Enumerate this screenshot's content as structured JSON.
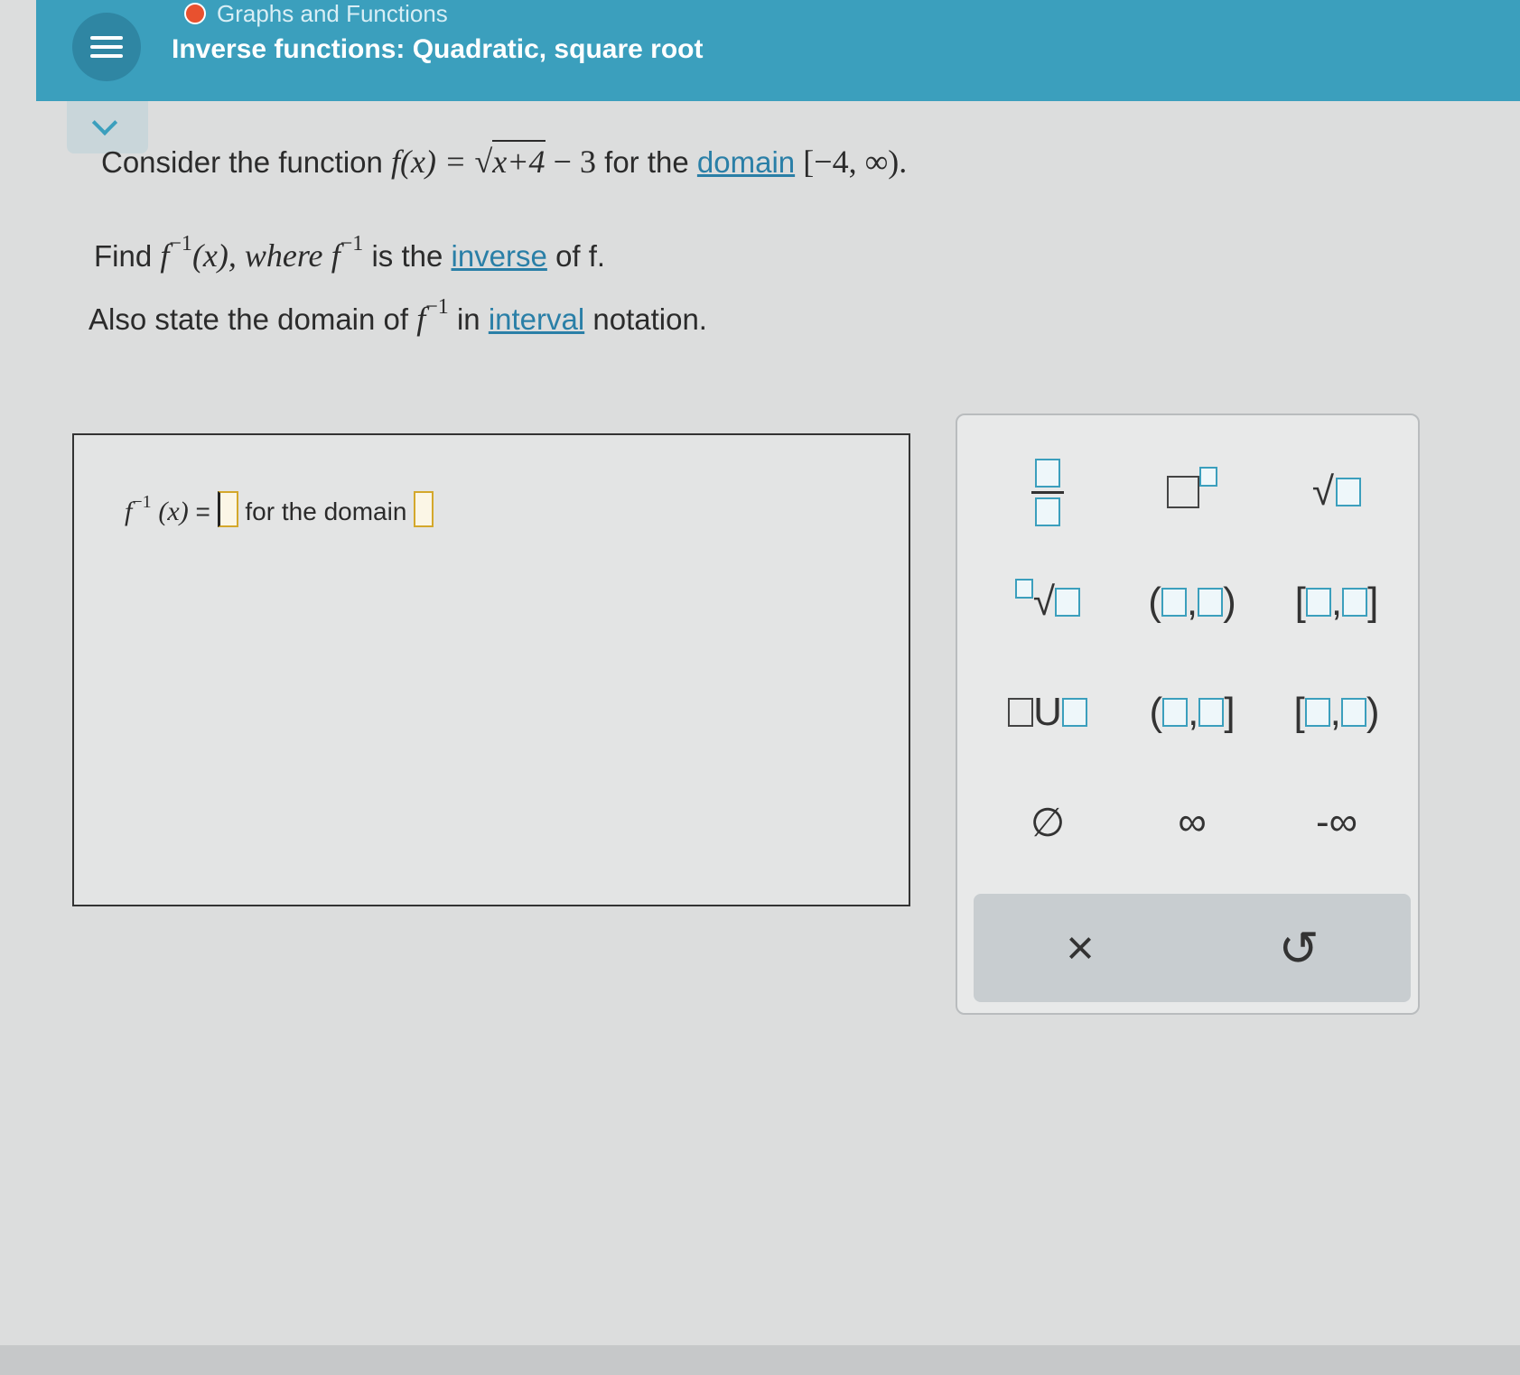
{
  "header": {
    "breadcrumb": "Graphs and Functions",
    "title": "Inverse functions: Quadratic, square root"
  },
  "question": {
    "line1_prefix": "Consider the function",
    "f_of_x": "f(x) =",
    "radicand": "x+4",
    "minus_three": "− 3",
    "for_the": "for the",
    "domain_link": "domain",
    "domain_value": "[−4, ∞).",
    "line2_find": "Find",
    "f_inv": "f",
    "sup": "−1",
    "of_x": "(x), where",
    "is_the": "is the",
    "inverse_link": "inverse",
    "of_f": "of f.",
    "line3_prefix": "Also state the domain of",
    "in": "in",
    "interval_link": "interval",
    "notation": "notation."
  },
  "answer": {
    "lhs_f": "f",
    "lhs_sup": "−1",
    "lhs_x": "(x)",
    "equals": "=",
    "for_the_domain": "for the domain"
  },
  "palette": {
    "open_paren": "(",
    "close_paren": ")",
    "open_bracket": "[",
    "close_bracket": "]",
    "comma": ",",
    "union": "U",
    "sqrt": "√",
    "empty_set": "∅",
    "infinity": "∞",
    "neg_infinity": "-∞",
    "clear": "×",
    "undo": "↺"
  },
  "colors": {
    "header": "#3b9fbd",
    "link": "#2a7fa7",
    "slot_border": "#d4a82b"
  }
}
